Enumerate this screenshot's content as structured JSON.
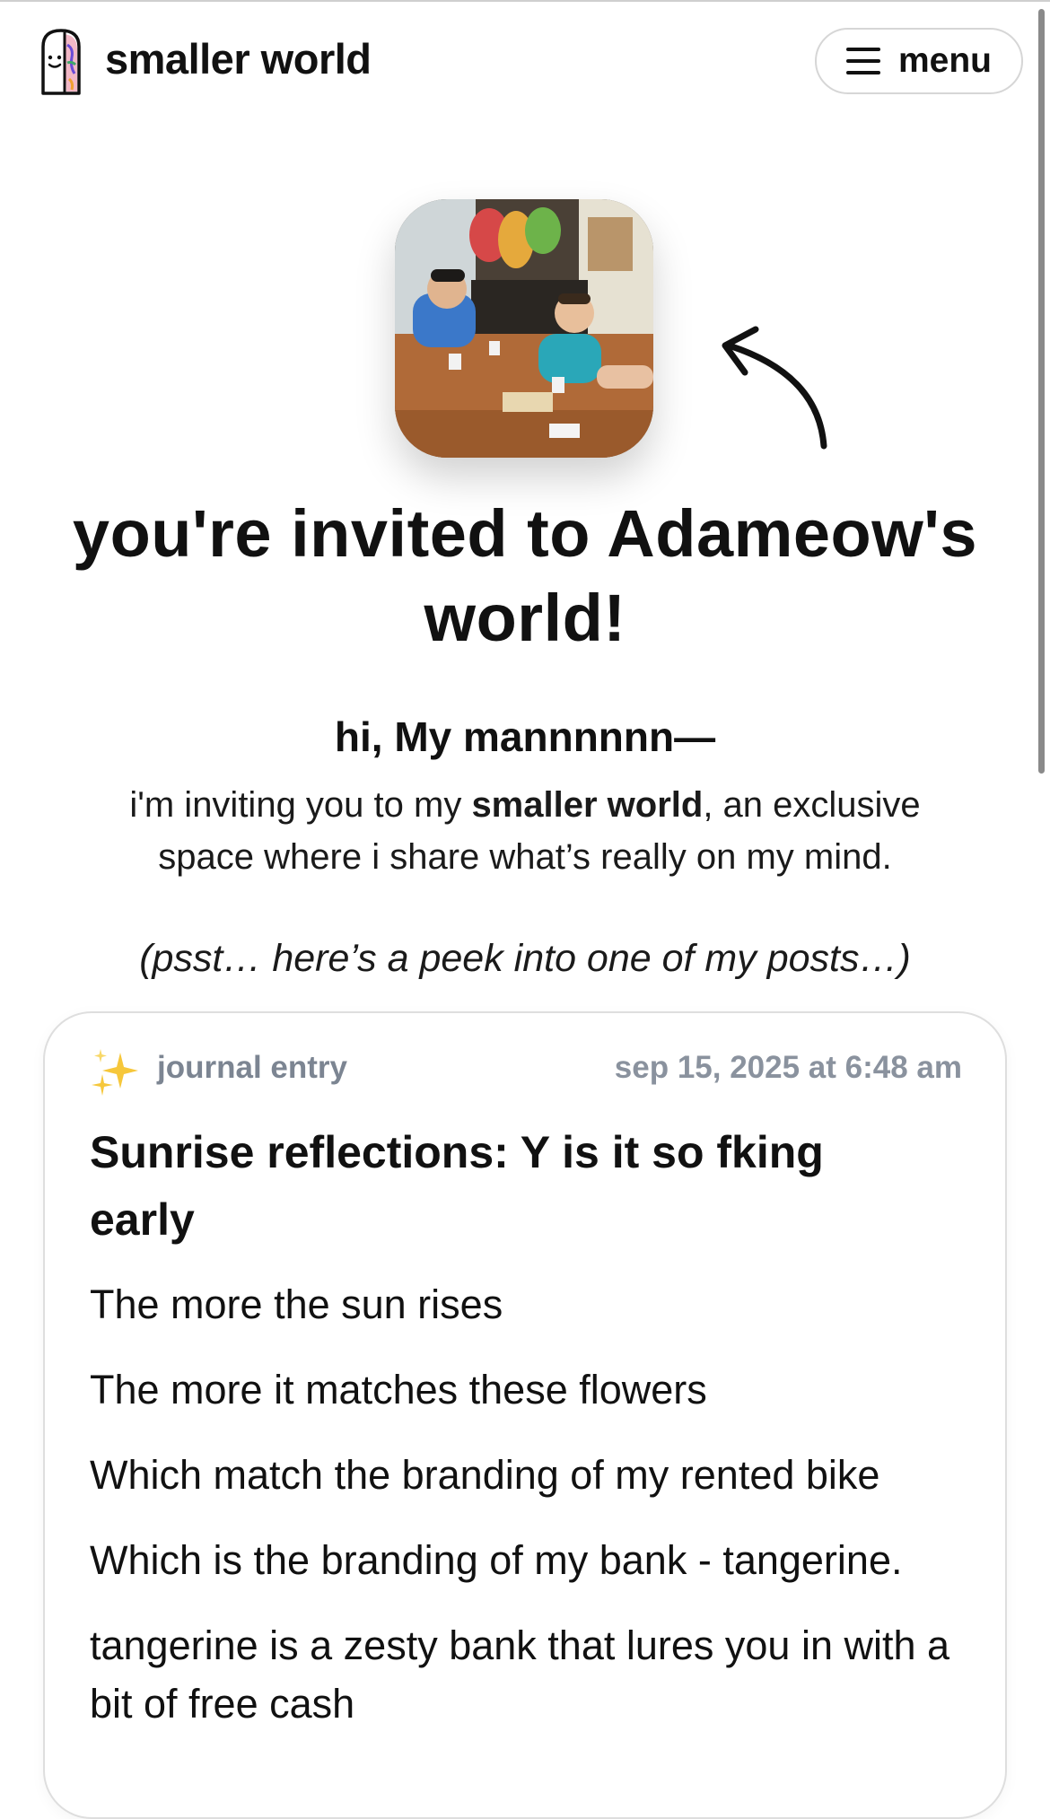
{
  "header": {
    "brand": "smaller world",
    "menu_label": "menu"
  },
  "invite": {
    "title_prefix": "you're invited to ",
    "title_name": "Adameow's world!",
    "greeting": "hi, My mannnnnn—",
    "intro_before": "i'm inviting you to my ",
    "intro_bold": "smaller world",
    "intro_after": ", an exclusive space where i share what’s really on my mind.",
    "peek": "(psst… here’s a peek into one of my posts…)"
  },
  "post": {
    "type_label": "journal entry",
    "date": "sep 15, 2025 at 6:48 am",
    "title": "Sunrise reflections: Y is it so fking early",
    "lines": [
      "The more the sun rises",
      "The more it matches these flowers",
      "Which match the branding of my rented bike",
      "Which is the branding of my bank - tangerine.",
      "tangerine is a zesty bank that lures you in with a bit of free cash"
    ]
  },
  "icons": {
    "logo": "door-logo-icon",
    "menu": "hamburger-menu-icon",
    "arrow": "curved-arrow-icon",
    "sparkle": "sparkles-icon"
  },
  "colors": {
    "text": "#111111",
    "muted": "#7c8592",
    "border": "#dedede"
  }
}
